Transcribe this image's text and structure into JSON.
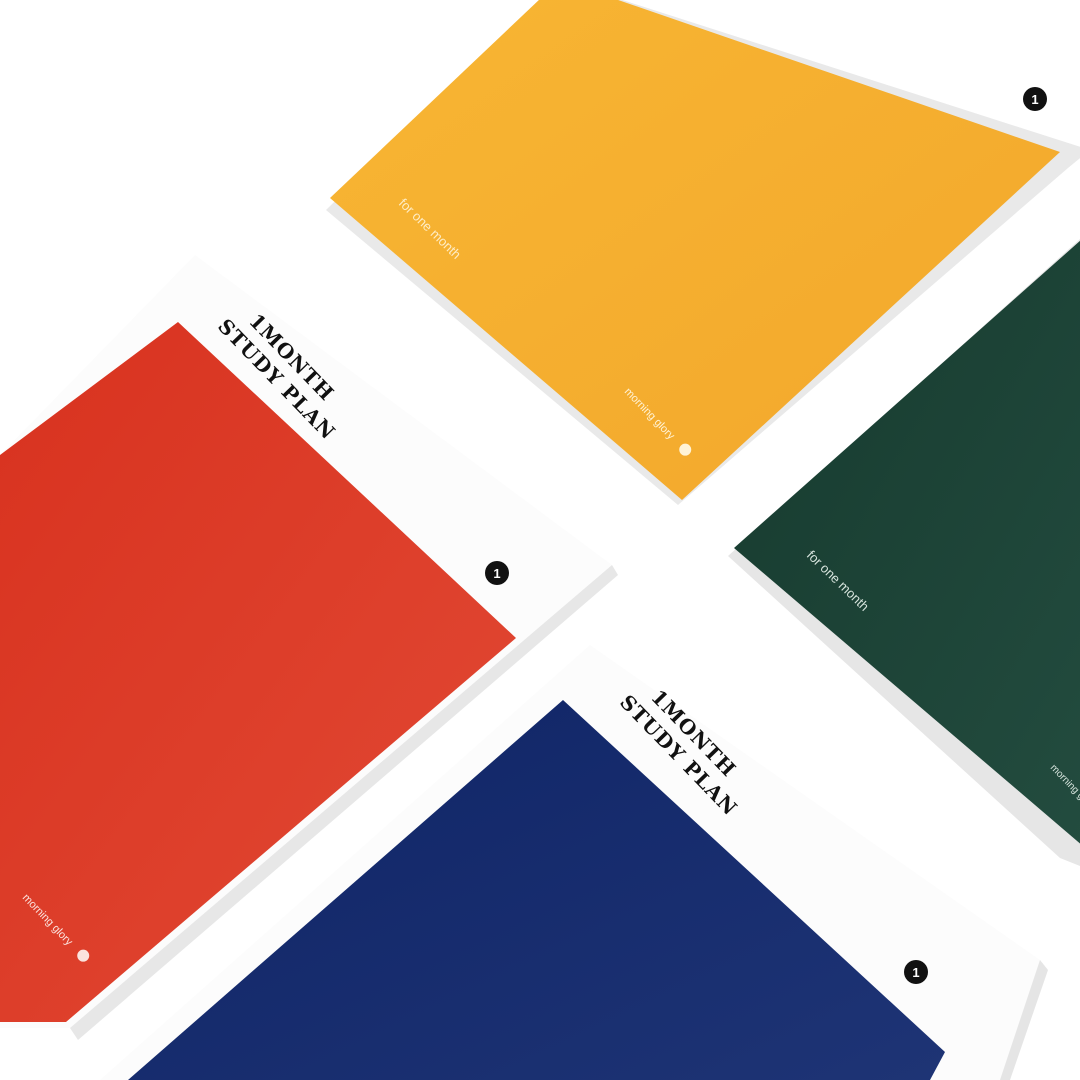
{
  "notebooks": [
    {
      "name": "yellow",
      "cover_color": "#F6B032",
      "tagline": "for one month",
      "brand": "morning glory",
      "badge": "1"
    },
    {
      "name": "green",
      "cover_color": "#1C4236",
      "tagline": "for one month",
      "brand": "morning glory"
    },
    {
      "name": "red",
      "cover_color": "#DD3A2A",
      "title_line1": "1MONTH",
      "title_line2": "STUDY PLAN",
      "badge": "1",
      "brand": "morning glory"
    },
    {
      "name": "blue",
      "cover_color": "#16286A",
      "title_line1": "1MONTH",
      "title_line2": "STUDY PLAN",
      "badge": "1"
    }
  ]
}
